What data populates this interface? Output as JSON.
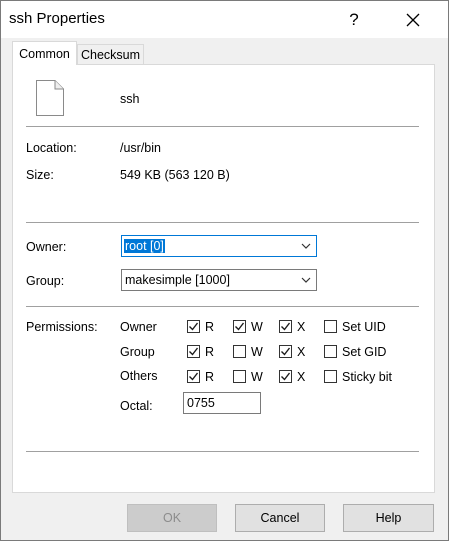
{
  "window": {
    "title": "ssh Properties",
    "help_glyph": "?",
    "close_glyph": "✕"
  },
  "tabs": [
    {
      "label": "Common",
      "selected": true
    },
    {
      "label": "Checksum",
      "selected": false
    }
  ],
  "file": {
    "name": "ssh",
    "icon": "file-icon"
  },
  "info": {
    "location_label": "Location:",
    "location_value": "/usr/bin",
    "size_label": "Size:",
    "size_value": "549 KB (563 120 B)"
  },
  "owner": {
    "label": "Owner:",
    "value": "root [0]"
  },
  "group": {
    "label": "Group:",
    "value": "makesimple [1000]"
  },
  "permissions": {
    "label": "Permissions:",
    "rows": [
      {
        "name": "Owner",
        "r": true,
        "w": true,
        "x": true,
        "extra_label": "Set UID",
        "extra": false
      },
      {
        "name": "Group",
        "r": true,
        "w": false,
        "x": true,
        "extra_label": "Set GID",
        "extra": false
      },
      {
        "name": "Others",
        "r": true,
        "w": false,
        "x": true,
        "extra_label": "Sticky bit",
        "extra": false
      }
    ],
    "r_label": "R",
    "w_label": "W",
    "x_label": "X",
    "octal_label": "Octal:",
    "octal_value": "0755"
  },
  "buttons": {
    "ok": "OK",
    "cancel": "Cancel",
    "help": "Help"
  },
  "colors": {
    "accent": "#0078d7",
    "check": "#1a1a1a"
  }
}
